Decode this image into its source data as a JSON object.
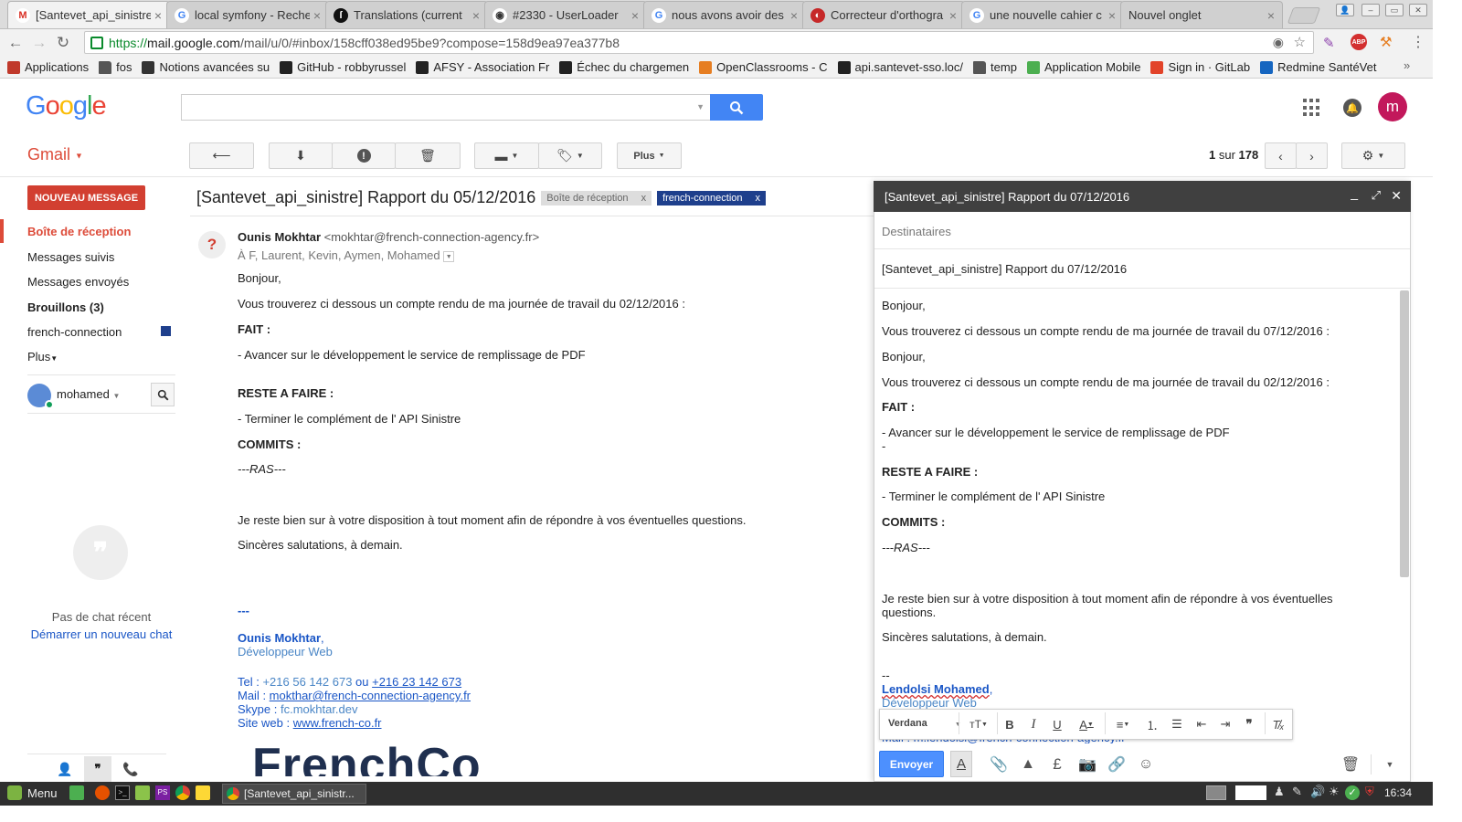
{
  "browser": {
    "tabs": [
      {
        "title": "[Santevet_api_sinistre",
        "icon": "gmail-icon",
        "active": true
      },
      {
        "title": "local symfony - Reche",
        "icon": "google-icon"
      },
      {
        "title": "Translations (current",
        "icon": "symfony-icon"
      },
      {
        "title": "#2330 - UserLoader",
        "icon": "github-icon"
      },
      {
        "title": "nous avons avoir des",
        "icon": "google-icon"
      },
      {
        "title": "Correcteur d'orthogra",
        "icon": "spellcheck-icon"
      },
      {
        "title": "une nouvelle cahier c",
        "icon": "google-icon"
      },
      {
        "title": "Nouvel onglet",
        "icon": ""
      }
    ],
    "url_scheme": "https://",
    "url_domain": "mail.google.com",
    "url_path": "/mail/u/0/#inbox/158cff038ed95be9?compose=158d9ea97ea377b8",
    "bookmarks": [
      {
        "label": "Applications",
        "icon": "apps-grid-icon",
        "color": "#c0392b"
      },
      {
        "label": "fos",
        "icon": "folder-icon",
        "color": "#555555"
      },
      {
        "label": "Notions avancées su",
        "icon": "book-icon",
        "color": "#333333"
      },
      {
        "label": "GitHub - robbyrussel",
        "icon": "github-icon",
        "color": "#222222"
      },
      {
        "label": "AFSY - Association Fr",
        "icon": "afsy-icon",
        "color": "#222222"
      },
      {
        "label": "Échec du chargemen",
        "icon": "symfony-icon",
        "color": "#222222"
      },
      {
        "label": "OpenClassrooms - C",
        "icon": "openclassrooms-icon",
        "color": "#e67e22"
      },
      {
        "label": "api.santevet-sso.loc/",
        "icon": "symfony-icon",
        "color": "#222222"
      },
      {
        "label": "temp",
        "icon": "folder-icon",
        "color": "#555555"
      },
      {
        "label": "Application Mobile",
        "icon": "android-icon",
        "color": "#4caf50"
      },
      {
        "label": "Sign in · GitLab",
        "icon": "gitlab-icon",
        "color": "#e24329"
      },
      {
        "label": "Redmine SantéVet",
        "icon": "redmine-icon",
        "color": "#1565c0"
      }
    ]
  },
  "gmail": {
    "logo": "Google",
    "app_label": "Gmail",
    "toolbar": {
      "more_label": "Plus",
      "pager_current": "1",
      "pager_sep": "sur",
      "pager_total": "178"
    },
    "compose_button": "NOUVEAU MESSAGE",
    "nav": {
      "inbox": "Boîte de réception",
      "starred": "Messages suivis",
      "sent": "Messages envoyés",
      "drafts": "Brouillons (3)",
      "label": "french-connection",
      "more": "Plus"
    },
    "hangouts": {
      "user": "mohamed",
      "no_chat": "Pas de chat récent",
      "start_chat": "Démarrer un nouveau chat"
    },
    "user_initial": "m",
    "accent_red": "#dd4b39",
    "label_blue": "#1e3f8c"
  },
  "message": {
    "subject": "[Santevet_api_sinistre] Rapport du 05/12/2016",
    "labels": [
      {
        "text": "Boîte de réception"
      },
      {
        "text": "french-connection"
      }
    ],
    "sender_name": "Ounis Mokhtar",
    "sender_email": "<mokhtar@french-connection-agency.fr>",
    "recipients": "À F, Laurent, Kevin, Aymen, Mohamed",
    "body": {
      "greeting": "Bonjour,",
      "intro": "Vous trouverez ci dessous un compte rendu de ma journée de travail du  02/12/2016 :",
      "fait_title": "FAIT :",
      "fait_item": " - Avancer sur le développement le service de remplissage de PDF",
      "reste_title": "RESTE A FAIRE :",
      "reste_item": "- Terminer le complément de l' API Sinistre",
      "commits_title": "COMMITS :",
      "commits_item": "---RAS---",
      "closing1": "Je reste bien sur à votre disposition à tout moment afin de répondre à vos éventuelles questions.",
      "closing2": "Sincères salutations, à demain."
    },
    "signature": {
      "dashes": "---",
      "name": "Ounis Mokhtar",
      "role": "Développeur Web",
      "tel_label": "Tel : ",
      "tel1": "+216 56 142 673",
      "tel_or": " ou  ",
      "tel2": "+216 23 142 673",
      "mail_label": "Mail : ",
      "mail": "mokthar@french-connection-agency.fr",
      "skype_label": "Skype : ",
      "skype": "fc.mokhtar.dev",
      "site_label": "Site web : ",
      "site": "www.french-co.fr",
      "logo_text": "FrenchCo"
    }
  },
  "compose": {
    "title": "[Santevet_api_sinistre] Rapport du 07/12/2016",
    "recipients_placeholder": "Destinataires",
    "subject": "[Santevet_api_sinistre] Rapport du 07/12/2016",
    "body": {
      "l1": "Bonjour,",
      "l2": "Vous trouverez ci dessous un compte rendu de ma journée de travail du  07/12/2016 :",
      "l3": "Bonjour,",
      "l4": "Vous trouverez ci dessous un compte rendu de ma journée de travail du  02/12/2016 :",
      "fait_title": "FAIT :",
      "fait_item": " - Avancer sur le développement le service de remplissage de PDF",
      "fait_item2": " -",
      "reste_title": "RESTE A FAIRE :",
      "reste_item": "- Terminer le complément de l' API Sinistre",
      "commits_title": "COMMITS :",
      "commits_item": "---RAS---",
      "closing1a": "Je reste bien sur à votre disposition à tout moment afin de répondre à vos éventuelles",
      "closing1b": "questions.",
      "closing2": "Sincères salutations, à demain.",
      "sig_dashes": "--",
      "sig_name": "Lendolsi Mohamed",
      "sig_role": "Développeur Web",
      "sig_hidden": "Mail : m.lendolsi@french-connection-agency.fr"
    },
    "font_name": "Verdana",
    "send_label": "Envoyer",
    "pound_symbol": "£"
  },
  "taskbar": {
    "menu_label": "Menu",
    "window_title": "[Santevet_api_sinistr...",
    "clock": "16:34"
  }
}
